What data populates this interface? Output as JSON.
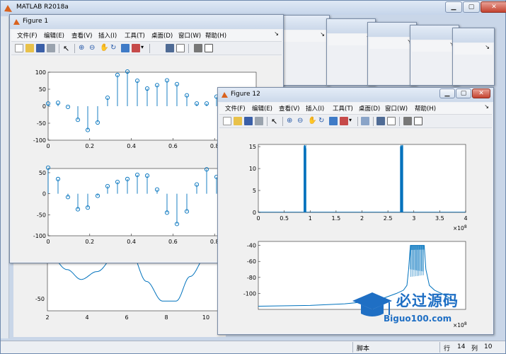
{
  "main_window": {
    "title": "MATLAB R2018a",
    "status": {
      "label": "脚本",
      "row_label": "行",
      "row": "14",
      "col_label": "列",
      "col": "10"
    }
  },
  "back_figure_axis": {
    "yticks": [
      "-50"
    ],
    "xticks": [
      "2",
      "4",
      "6",
      "8",
      "10"
    ]
  },
  "figure1": {
    "title": "Figure 1",
    "menus": [
      "文件(F)",
      "编辑(E)",
      "查看(V)",
      "插入(I)",
      "工具(T)",
      "桌面(D)",
      "窗口(W)",
      "帮助(H)"
    ],
    "top_plot": {
      "yticks": [
        "100",
        "50",
        "0",
        "-50",
        "-100"
      ],
      "xticks": [
        "0",
        "0.2",
        "0.4",
        "0.6",
        "0.8"
      ]
    },
    "bottom_plot": {
      "yticks": [
        "50",
        "0",
        "-50",
        "-100"
      ],
      "xticks": [
        "0",
        "0.2",
        "0.4",
        "0.6",
        "0.8"
      ]
    }
  },
  "figure12": {
    "title": "Figure 12",
    "menus": [
      "文件(F)",
      "编辑(E)",
      "查看(V)",
      "插入(I)",
      "工具(T)",
      "桌面(D)",
      "窗口(W)",
      "帮助(H)"
    ],
    "top_plot": {
      "yticks": [
        "15",
        "10",
        "5",
        "0"
      ],
      "xticks": [
        "0",
        "0.5",
        "1",
        "1.5",
        "2",
        "2.5",
        "3",
        "3.5",
        "4"
      ],
      "exponent": "×10",
      "exponent_power": "8"
    },
    "bottom_plot": {
      "yticks": [
        "-40",
        "-60",
        "-80",
        "-100"
      ],
      "exponent": "×10",
      "exponent_power": "8"
    }
  },
  "watermark": {
    "text": "必过源码",
    "url": "Biguo100.com"
  },
  "chart_data": [
    {
      "type": "stem",
      "x": [
        0,
        0.0476,
        0.0952,
        0.1429,
        0.1905,
        0.2381,
        0.2857,
        0.3333,
        0.381,
        0.4286,
        0.4762,
        0.5238,
        0.5714,
        0.619,
        0.6667,
        0.7143,
        0.7619,
        0.8095,
        0.8571,
        0.9048
      ],
      "y": [
        8,
        10,
        -2,
        -40,
        -70,
        -48,
        25,
        92,
        102,
        75,
        52,
        62,
        76,
        65,
        32,
        8,
        8,
        28,
        0,
        0
      ],
      "xlim": [
        0,
        1
      ],
      "ylim": [
        -100,
        100
      ]
    },
    {
      "type": "stem",
      "x": [
        0,
        0.0476,
        0.0952,
        0.1429,
        0.1905,
        0.2381,
        0.2857,
        0.3333,
        0.381,
        0.4286,
        0.4762,
        0.5238,
        0.5714,
        0.619,
        0.6667,
        0.7143,
        0.7619,
        0.8095,
        0.8571,
        0.9048
      ],
      "y": [
        62,
        35,
        -8,
        -37,
        -33,
        -5,
        18,
        28,
        35,
        45,
        43,
        10,
        -45,
        -72,
        -42,
        22,
        58,
        40,
        0,
        0
      ],
      "xlim": [
        0,
        1
      ],
      "ylim": [
        -100,
        60
      ]
    },
    {
      "type": "line",
      "x": [
        0,
        0.88,
        0.88,
        0.92,
        0.92,
        2.74,
        2.74,
        2.79,
        2.79,
        4
      ],
      "y": [
        0,
        0,
        16,
        16,
        0,
        0,
        16,
        16,
        0,
        0
      ],
      "xlim": [
        0,
        4
      ],
      "ylim": [
        0,
        15.5
      ]
    },
    {
      "type": "line",
      "x": [
        0,
        0.3,
        0.5,
        0.6,
        0.7,
        0.75,
        0.8,
        0.84,
        0.86,
        0.87,
        0.88,
        0.96,
        0.97,
        0.99,
        1.02,
        1.06,
        1.1,
        1.14
      ],
      "y": [
        -116,
        -115,
        -113,
        -111,
        -108,
        -104,
        -100,
        -96,
        -90,
        -70,
        -40,
        -40,
        -70,
        -90,
        -96,
        -100,
        -105,
        -110
      ],
      "ylim": [
        -120,
        -35
      ]
    },
    {
      "type": "line",
      "x": [
        2,
        3,
        3.7,
        4.5,
        5.5,
        6.2,
        7,
        7.8,
        8.5,
        9.2,
        10,
        10.6
      ],
      "y": [
        -10,
        -28,
        -38,
        -30,
        -12,
        -10,
        -40,
        -60,
        -60,
        -35,
        -15,
        -10
      ],
      "xlim": [
        2,
        11
      ],
      "ylim": [
        -70,
        -5
      ]
    }
  ]
}
